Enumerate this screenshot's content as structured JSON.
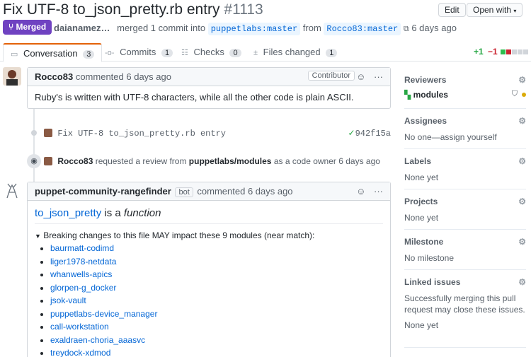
{
  "pr": {
    "title": "Fix UTF-8 to_json_pretty.rb entry",
    "number": "#1113",
    "status": "Merged",
    "author": "daianamez…",
    "merge_text": "merged 1 commit into",
    "base_branch": "puppetlabs:master",
    "from_text": "from",
    "head_branch": "Rocco83:master",
    "time": "6 days ago"
  },
  "header_buttons": {
    "edit": "Edit",
    "open_with": "Open with"
  },
  "tabs": [
    {
      "label": "Conversation",
      "count": "3"
    },
    {
      "label": "Commits",
      "count": "1"
    },
    {
      "label": "Checks",
      "count": "0"
    },
    {
      "label": "Files changed",
      "count": "1"
    }
  ],
  "diffstat": {
    "additions": "+1",
    "deletions": "−1"
  },
  "comment1": {
    "author": "Rocco83",
    "action": "commented",
    "time": "6 days ago",
    "badge": "Contributor",
    "body": "Ruby's is written with UTF-8 characters, while all the other code is plain ASCII."
  },
  "commit_event": {
    "message": "Fix UTF-8 to_json_pretty.rb entry",
    "sha": "942f15a"
  },
  "review_event": {
    "user": "Rocco83",
    "text1": "requested a review from",
    "team": "puppetlabs/modules",
    "text2": "as a code owner",
    "time": "6 days ago"
  },
  "comment2": {
    "author": "puppet-community-rangefinder",
    "bot_badge": "bot",
    "action": "commented",
    "time": "6 days ago",
    "heading_link": "to_json_pretty",
    "heading_mid": "is a",
    "heading_em": "function",
    "summary": "Breaking changes to this file MAY impact these 9 modules (near match):",
    "modules": [
      "baurmatt-codimd",
      "liger1978-netdata",
      "whanwells-apics",
      "glorpen-g_docker",
      "jsok-vault",
      "puppetlabs-device_manager",
      "call-workstation",
      "exaldraen-choria_aaasvc",
      "treydock-xdmod"
    ]
  },
  "sidebar": {
    "reviewers": {
      "title": "Reviewers",
      "value": "modules"
    },
    "assignees": {
      "title": "Assignees",
      "value": "No one—assign yourself"
    },
    "labels": {
      "title": "Labels",
      "value": "None yet"
    },
    "projects": {
      "title": "Projects",
      "value": "None yet"
    },
    "milestone": {
      "title": "Milestone",
      "value": "No milestone"
    },
    "linked_issues": {
      "title": "Linked issues",
      "description": "Successfully merging this pull request may close these issues.",
      "value": "None yet"
    }
  },
  "colors": {
    "merged": "#6f42c1",
    "link": "#0366d6",
    "add": "#28a745",
    "del": "#cb2431",
    "active_tab": "#e36209"
  }
}
